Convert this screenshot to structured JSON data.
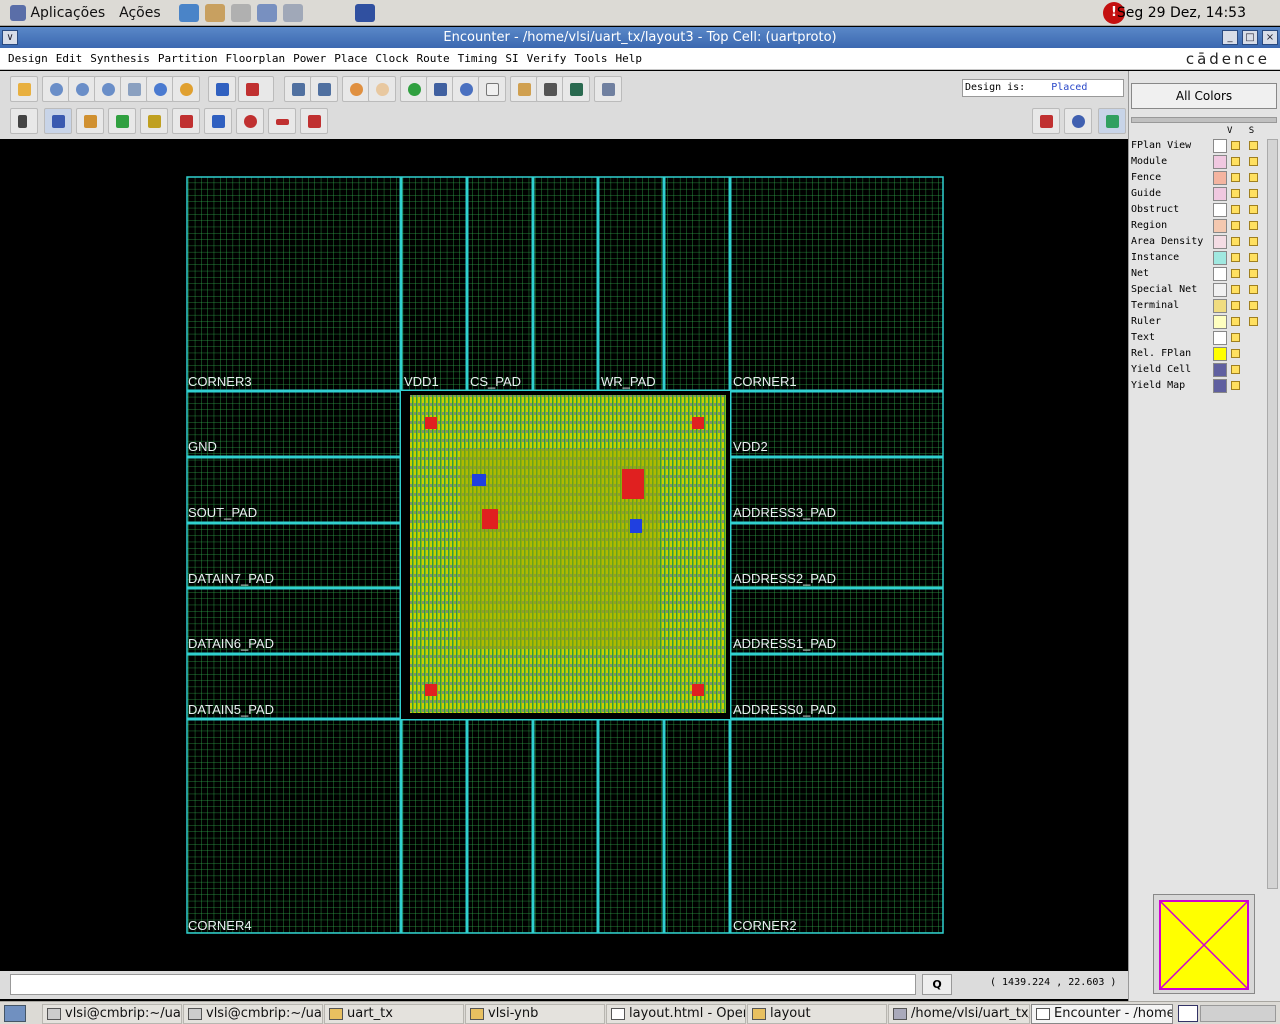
{
  "top_panel": {
    "apps_label": "Aplicações",
    "actions_label": "Ações",
    "clock": "Seg 29 Dez, 14:53",
    "alert_glyph": "!"
  },
  "window": {
    "title": "Encounter - /home/vlsi/uart_tx/layout3 - Top Cell: (uartproto)",
    "btn_menu": "∨",
    "btn_min": "_",
    "btn_max": "□",
    "btn_close": "×"
  },
  "menubar": {
    "items": [
      "Design",
      "Edit",
      "Synthesis",
      "Partition",
      "Floorplan",
      "Power",
      "Place",
      "Clock",
      "Route",
      "Timing",
      "SI",
      "Verify",
      "Tools",
      "Help"
    ],
    "brand": "cādence"
  },
  "toolbar": {
    "status_label": "Design is:",
    "status_value": "Placed"
  },
  "right_panel": {
    "all_colors": "All Colors",
    "col_v": "V",
    "col_s": "S",
    "layers": [
      {
        "name": "FPlan View",
        "color": "#ffffff"
      },
      {
        "name": "Module",
        "color": "#f0c8e0"
      },
      {
        "name": "Fence",
        "color": "#f4b4a0"
      },
      {
        "name": "Guide",
        "color": "#f0c8e0"
      },
      {
        "name": "Obstruct",
        "color": "#ffffff"
      },
      {
        "name": "Region",
        "color": "#f4c8b0"
      },
      {
        "name": "Area Density",
        "color": "#f4dce4"
      },
      {
        "name": "Instance",
        "color": "#a0e8e0"
      },
      {
        "name": "Net",
        "color": "#ffffff"
      },
      {
        "name": "Special Net",
        "color": "#f0f0f0"
      },
      {
        "name": "Terminal",
        "color": "#f0dc80"
      },
      {
        "name": "Ruler",
        "color": "#ffffc0"
      },
      {
        "name": "Text",
        "color": "#ffffff"
      },
      {
        "name": "Rel. FPlan",
        "color": "#ffff00"
      },
      {
        "name": "Yield Cell",
        "color": "#6060a0"
      },
      {
        "name": "Yield Map",
        "color": "#6060a0"
      }
    ]
  },
  "layout": {
    "pads": [
      "CORNER3",
      "VDD1",
      "CS_PAD",
      "WR_PAD",
      "CORNER1",
      "GND",
      "VDD2",
      "SOUT_PAD",
      "ADDRESS3_PAD",
      "DATAIN7_PAD",
      "ADDRESS2_PAD",
      "DATAIN6_PAD",
      "ADDRESS1_PAD",
      "DATAIN5_PAD",
      "ADDRESS0_PAD",
      "CORNER4",
      "CORNER2"
    ]
  },
  "cmdline": {
    "q_label": "Q",
    "coords": "( 1439.224 ,    22.603 )"
  },
  "taskbar": {
    "tasks": [
      "vlsi@cmbrip:~/uart_",
      "vlsi@cmbrip:~/uart_",
      "uart_tx",
      "vlsi-ynb",
      "layout.html - OpenC",
      "layout",
      "/home/vlsi/uart_tx/la",
      "Encounter - /home/v"
    ]
  }
}
